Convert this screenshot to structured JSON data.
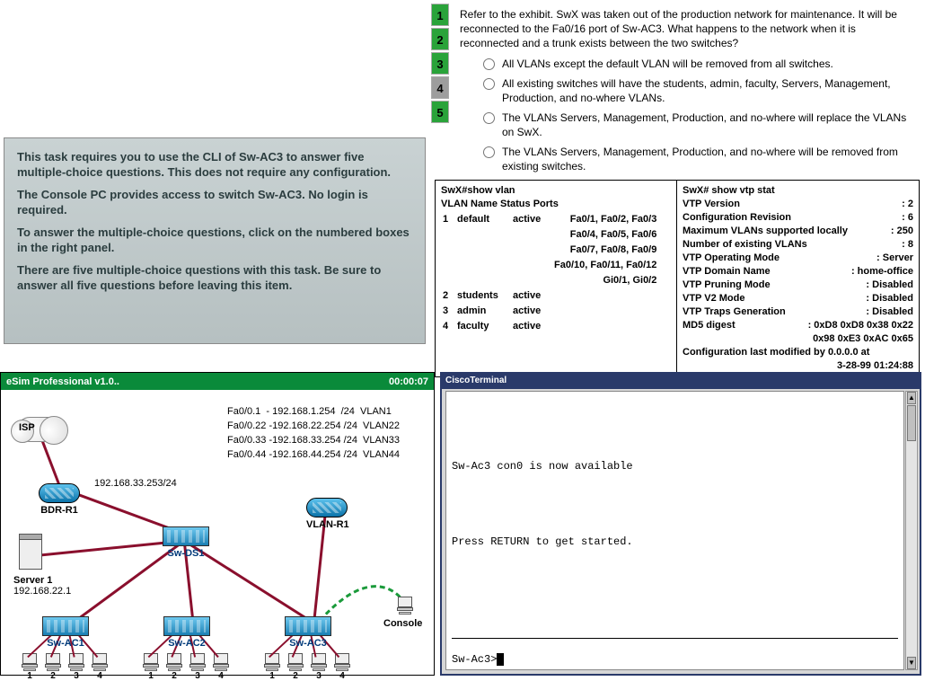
{
  "instructions": {
    "p1": "This task requires you to use the CLI of Sw-AC3 to answer five multiple-choice questions. This does not require any configuration.",
    "p2": "The Console PC provides access to switch Sw-AC3.  No login is required.",
    "p3": "To answer the multiple-choice questions, click on the numbered boxes in the right panel.",
    "p4": "There are five multiple-choice questions with this task. Be sure to answer all five questions before leaving this item."
  },
  "question": {
    "numbers": [
      "1",
      "2",
      "3",
      "4",
      "5"
    ],
    "selected": 4,
    "stem": "Refer to the exhibit. SwX was taken out of the production network for maintenance. It will be reconnected to the Fa0/16 port of Sw-AC3. What happens to the network when it is reconnected and a trunk exists between the two switches?",
    "options": [
      "All VLANs except the default VLAN will be removed from all switches.",
      "All existing switches will have the students, admin, faculty, Servers, Management, Production, and no-where VLANs.",
      "The VLANs Servers, Management, Production, and no-where will replace the VLANs on SwX.",
      "The VLANs Servers, Management, Production, and no-where will be removed from existing switches."
    ]
  },
  "cli_left": {
    "cmd": "SwX#show vlan",
    "hdr": "VLAN Name    Status    Ports",
    "rows": [
      {
        "id": "1",
        "name": "default",
        "status": "active",
        "ports": "Fa0/1, Fa0/2, Fa0/3"
      },
      {
        "id": "",
        "name": "",
        "status": "",
        "ports": "Fa0/4, Fa0/5, Fa0/6"
      },
      {
        "id": "",
        "name": "",
        "status": "",
        "ports": "Fa0/7, Fa0/8, Fa0/9"
      },
      {
        "id": "",
        "name": "",
        "status": "",
        "ports": "Fa0/10, Fa0/11, Fa0/12"
      },
      {
        "id": "",
        "name": "",
        "status": "",
        "ports": "Gi0/1, Gi0/2"
      },
      {
        "id": "2",
        "name": "students",
        "status": "active",
        "ports": ""
      },
      {
        "id": "3",
        "name": "admin",
        "status": "active",
        "ports": ""
      },
      {
        "id": "4",
        "name": "faculty",
        "status": "active",
        "ports": ""
      }
    ]
  },
  "cli_right": {
    "cmd": "SwX#  show vtp stat",
    "rows": [
      {
        "k": "VTP Version",
        "v": ": 2"
      },
      {
        "k": "Configuration Revision",
        "v": ": 6"
      },
      {
        "k": "Maximum VLANs supported locally",
        "v": ": 250"
      },
      {
        "k": "Number of existing VLANs",
        "v": ": 8"
      },
      {
        "k": "VTP Operating Mode",
        "v": ": Server"
      },
      {
        "k": "VTP Domain Name",
        "v": ": home-office"
      },
      {
        "k": "VTP Pruning Mode",
        "v": ": Disabled"
      },
      {
        "k": "VTP V2 Mode",
        "v": ": Disabled"
      },
      {
        "k": "VTP Traps Generation",
        "v": ": Disabled"
      },
      {
        "k": "MD5 digest",
        "v": ": 0xD8 0xD8 0x38 0x22"
      },
      {
        "k": "",
        "v": "0x98 0xE3 0xAC 0x65"
      }
    ],
    "footer1": "Configuration last modified by 0.0.0.0  at",
    "footer2": "3-28-99  01:24:88"
  },
  "esim": {
    "title": "eSim Professional v1.0..",
    "timer": "00:00:07",
    "iplist": [
      "Fa0/0.1  - 192.168.1.254  /24  VLAN1",
      "Fa0/0.22 -192.168.22.254 /24  VLAN22",
      "Fa0/0.33 -192.168.33.254 /24  VLAN33",
      "Fa0/0.44 -192.168.44.254 /24  VLAN44"
    ],
    "labels": {
      "isp": "ISP",
      "bdr_ip": "192.168.33.253/24",
      "bdr": "BDR-R1",
      "vlanr": "VLAN-R1",
      "ds1": "Sw-DS1",
      "server_name": "Server 1",
      "server_ip": "192.168.22.1",
      "ac1": "Sw-AC1",
      "ac2": "Sw-AC2",
      "ac3": "Sw-AC3",
      "console": "Console"
    },
    "pc_nums": [
      "1",
      "2",
      "3",
      "4"
    ]
  },
  "terminal": {
    "title": "CiscoTerminal",
    "body": "\n\n\n\n\nSw-Ac3 con0 is now available\n\n\n\n\n\nPress RETURN to get started.",
    "prompt": "Sw-Ac3>"
  }
}
